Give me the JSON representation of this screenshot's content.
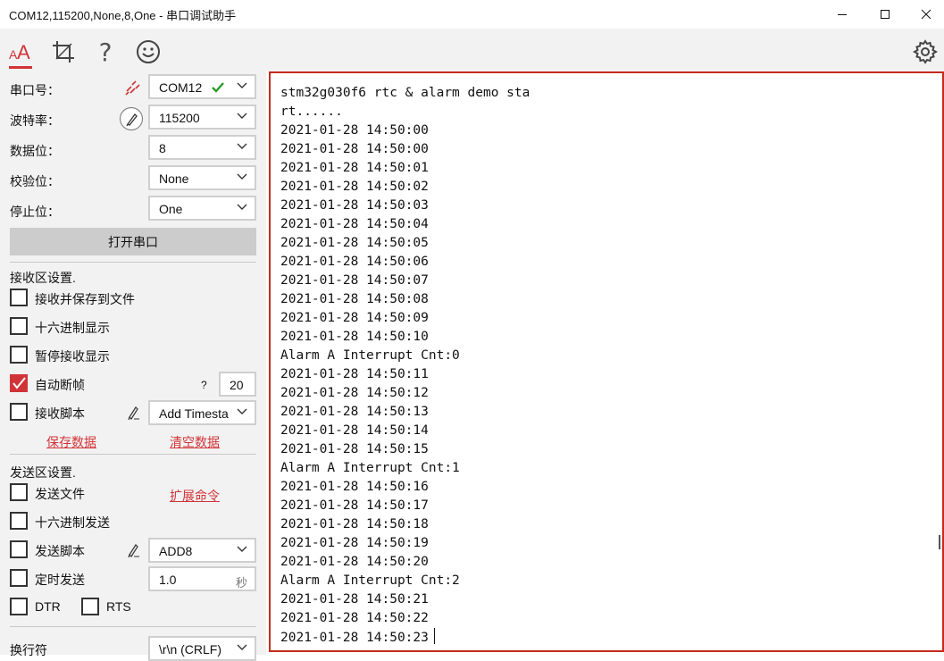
{
  "window": {
    "title": "COM12,115200,None,8,One - 串口调试助手"
  },
  "toolbar": {
    "icons": [
      "font-icon",
      "crop-icon",
      "help-icon",
      "smiley-icon",
      "gear-icon"
    ],
    "help_glyph": "?",
    "active_color": "#d13438"
  },
  "serial": {
    "port_label": "串口号：",
    "port_value": "COM12",
    "baud_label": "波特率：",
    "baud_value": "115200",
    "databits_label": "数据位：",
    "databits_value": "8",
    "parity_label": "校验位：",
    "parity_value": "None",
    "stopbits_label": "停止位：",
    "stopbits_value": "One",
    "open_button": "打开串口"
  },
  "receive": {
    "section_title": "接收区设置.",
    "save_to_file": "接收并保存到文件",
    "hex_display": "十六进制显示",
    "pause_display": "暂停接收显示",
    "auto_frame": "自动断帧",
    "auto_frame_checked": true,
    "auto_frame_help": "?",
    "auto_frame_value": "20",
    "script_label": "接收脚本",
    "script_value": "Add Timesta",
    "save_data_link": "保存数据",
    "clear_data_link": "清空数据"
  },
  "send": {
    "section_title": "发送区设置.",
    "send_file": "发送文件",
    "expand_cmd_link": "扩展命令",
    "hex_send": "十六进制发送",
    "script_label": "发送脚本",
    "script_value": "ADD8",
    "timer_label": "定时发送",
    "timer_value": "1.0",
    "timer_unit": "秒",
    "dtr_label": "DTR",
    "rts_label": "RTS",
    "newline_label": "换行符",
    "newline_value": "\\r\\n (CRLF)"
  },
  "terminal": {
    "border_color": "#c42b1c",
    "lines": [
      "stm32g030f6 rtc & alarm demo sta",
      "rt......",
      "2021-01-28 14:50:00",
      "2021-01-28 14:50:00",
      "2021-01-28 14:50:01",
      "2021-01-28 14:50:02",
      "2021-01-28 14:50:03",
      "2021-01-28 14:50:04",
      "2021-01-28 14:50:05",
      "2021-01-28 14:50:06",
      "2021-01-28 14:50:07",
      "2021-01-28 14:50:08",
      "2021-01-28 14:50:09",
      "2021-01-28 14:50:10",
      "Alarm A Interrupt Cnt:0",
      "2021-01-28 14:50:11",
      "2021-01-28 14:50:12",
      "2021-01-28 14:50:13",
      "2021-01-28 14:50:14",
      "2021-01-28 14:50:15",
      "Alarm A Interrupt Cnt:1",
      "2021-01-28 14:50:16",
      "2021-01-28 14:50:17",
      "2021-01-28 14:50:18",
      "2021-01-28 14:50:19",
      "2021-01-28 14:50:20",
      "Alarm A Interrupt Cnt:2",
      "2021-01-28 14:50:21",
      "2021-01-28 14:50:22",
      "2021-01-28 14:50:23"
    ]
  }
}
